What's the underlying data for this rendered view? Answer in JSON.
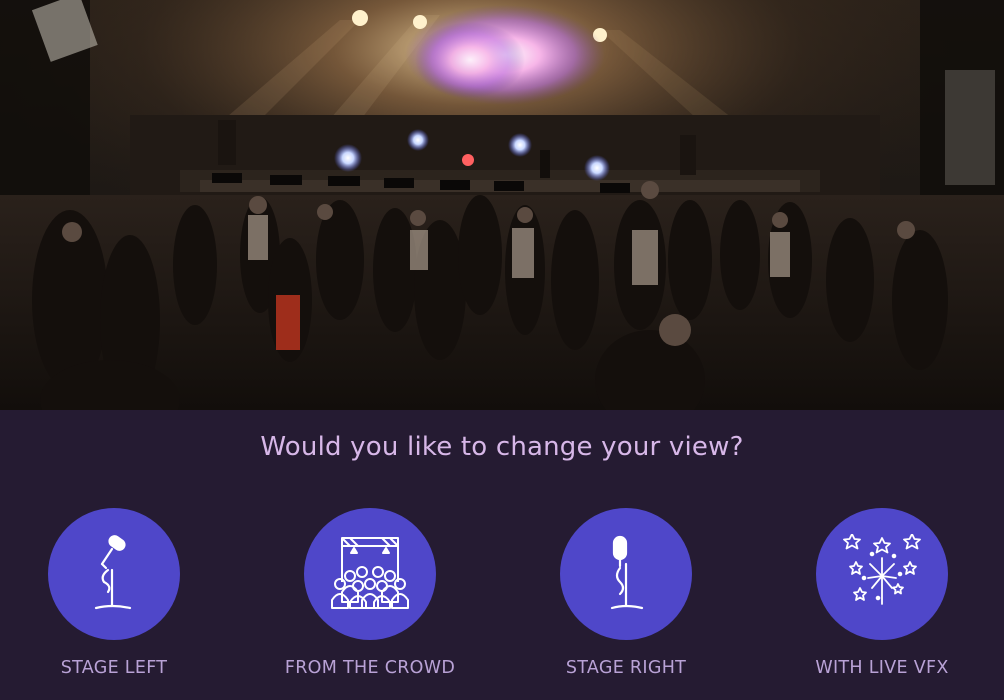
{
  "prompt": "Would you like to change your view?",
  "views": [
    {
      "label": "STAGE LEFT",
      "icon": "microphone-stand-icon"
    },
    {
      "label": "FROM THE CROWD",
      "icon": "stage-crowd-icon"
    },
    {
      "label": "STAGE RIGHT",
      "icon": "microphone-stand-icon"
    },
    {
      "label": "WITH LIVE VFX",
      "icon": "fireworks-icon"
    }
  ],
  "colors": {
    "background": "#251b32",
    "accent_circle": "#4f47c9",
    "prompt_text": "#d7b7e8",
    "label_text": "#b9a2d6"
  }
}
